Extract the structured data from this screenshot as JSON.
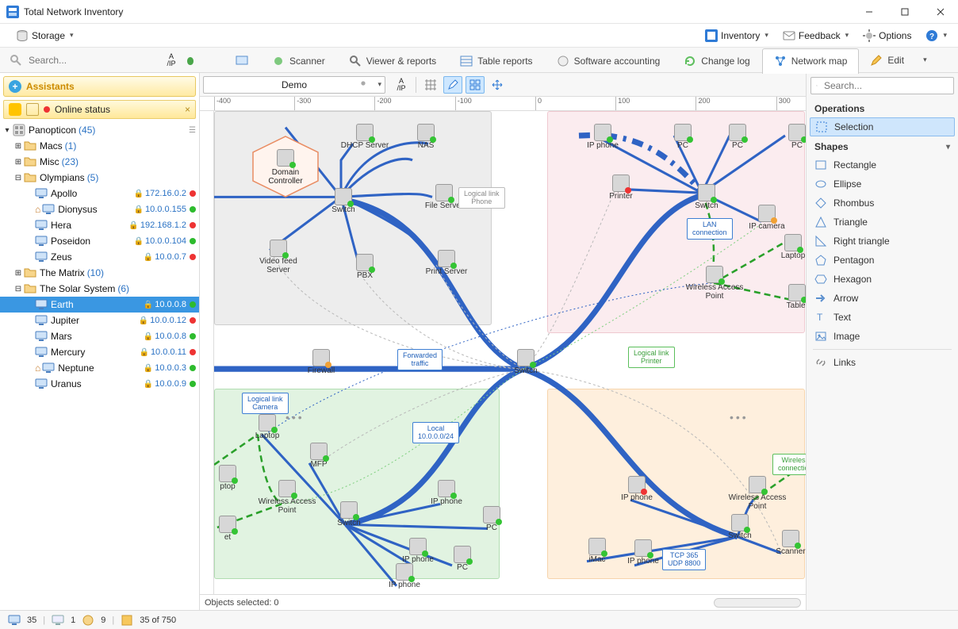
{
  "app": {
    "title": "Total Network Inventory"
  },
  "menu": {
    "storage": "Storage",
    "inventory": "Inventory",
    "feedback": "Feedback",
    "options": "Options"
  },
  "toolbar": {
    "search_placeholder": "Search...",
    "tabs": {
      "scanner": "Scanner",
      "viewer": "Viewer & reports",
      "table": "Table reports",
      "software": "Software accounting",
      "changelog": "Change log",
      "networkmap": "Network map"
    },
    "edit": "Edit"
  },
  "sidebar": {
    "assistants": "Assistants",
    "online_status": "Online status",
    "root": {
      "name": "Panopticon",
      "count": "(45)"
    },
    "folders": [
      {
        "name": "Macs",
        "count": "(1)",
        "exp": "+"
      },
      {
        "name": "Misc",
        "count": "(23)",
        "exp": "+"
      },
      {
        "name": "Olympians",
        "count": "(5)",
        "exp": "−",
        "children": [
          {
            "name": "Apollo",
            "ip": "172.16.0.2",
            "status": "red"
          },
          {
            "name": "Dionysus",
            "ip": "10.0.0.155",
            "status": "green"
          },
          {
            "name": "Hera",
            "ip": "192.168.1.2",
            "status": "red"
          },
          {
            "name": "Poseidon",
            "ip": "10.0.0.104",
            "status": "green"
          },
          {
            "name": "Zeus",
            "ip": "10.0.0.7",
            "status": "red"
          }
        ]
      },
      {
        "name": "The Matrix",
        "count": "(10)",
        "exp": "+"
      },
      {
        "name": "The Solar System",
        "count": "(6)",
        "exp": "−",
        "children": [
          {
            "name": "Earth",
            "ip": "10.0.0.8",
            "status": "green",
            "selected": true
          },
          {
            "name": "Jupiter",
            "ip": "10.0.0.12",
            "status": "red"
          },
          {
            "name": "Mars",
            "ip": "10.0.0.8",
            "status": "green"
          },
          {
            "name": "Mercury",
            "ip": "10.0.0.11",
            "status": "red"
          },
          {
            "name": "Neptune",
            "ip": "10.0.0.3",
            "status": "green"
          },
          {
            "name": "Uranus",
            "ip": "10.0.0.9",
            "status": "green"
          }
        ]
      }
    ]
  },
  "map": {
    "dropdown": "Demo",
    "ruler_ticks": [
      "-400",
      "-300",
      "-200",
      "-100",
      "0",
      "100",
      "200",
      "300"
    ],
    "status": "Objects selected: 0",
    "labels": {
      "logical_phone": "Logical link\nPhone",
      "lan_conn": "LAN\nconnection",
      "forwarded": "Forwarded\ntraffic",
      "logical_printer": "Logical link\nPrinter",
      "logical_camera": "Logical link\nCamera",
      "local": "Local\n10.0.0.0/24",
      "wireless_conn": "Wireless\nconnection",
      "tcp": "TCP 365\nUDP 8800"
    },
    "nodes": {
      "dc": "Domain\nController",
      "dhcp": "DHCP Server",
      "nas": "NAS",
      "fileserver": "File Server",
      "switch": "Switch",
      "videofeed": "Video feed\nServer",
      "pbx": "PBX",
      "printserver": "Print Server",
      "ipphone": "IP phone",
      "pc": "PC",
      "printer": "Printer",
      "ipcamera": "IP camera",
      "wap": "Wireless Access\nPoint",
      "laptop": "Laptop",
      "tablet": "Tablet",
      "firewall": "Firewall",
      "mfp": "MFP",
      "imac": "iMac",
      "scanner": "Scanner"
    }
  },
  "right": {
    "search_placeholder": "Search...",
    "operations": "Operations",
    "selection": "Selection",
    "shapes_head": "Shapes",
    "shapes": [
      "Rectangle",
      "Ellipse",
      "Rhombus",
      "Triangle",
      "Right triangle",
      "Pentagon",
      "Hexagon",
      "Arrow",
      "Text",
      "Image"
    ],
    "links": "Links"
  },
  "statusbar": {
    "pc": "35",
    "pc2": "1",
    "net": "9",
    "scanned": "35 of 750"
  }
}
